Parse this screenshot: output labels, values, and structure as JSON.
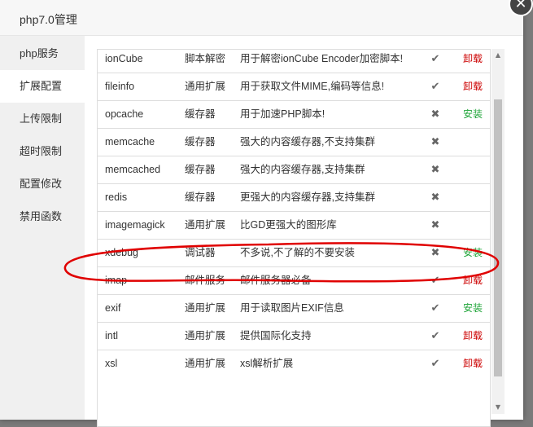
{
  "dialog": {
    "title": "php7.0管理",
    "close_glyph": "✕"
  },
  "sidebar": {
    "items": [
      {
        "label": "php服务",
        "active": false
      },
      {
        "label": "扩展配置",
        "active": true
      },
      {
        "label": "上传限制",
        "active": false
      },
      {
        "label": "超时限制",
        "active": false
      },
      {
        "label": "配置修改",
        "active": false
      },
      {
        "label": "禁用函数",
        "active": false
      }
    ]
  },
  "extensions": {
    "rows": [
      {
        "name": "ionCube",
        "type": "脚本解密",
        "desc": "用于解密ionCube Encoder加密脚本!",
        "installed": true,
        "action": "卸载"
      },
      {
        "name": "fileinfo",
        "type": "通用扩展",
        "desc": "用于获取文件MIME,编码等信息!",
        "installed": true,
        "action": "卸载"
      },
      {
        "name": "opcache",
        "type": "缓存器",
        "desc": "用于加速PHP脚本!",
        "installed": false,
        "action": "安装"
      },
      {
        "name": "memcache",
        "type": "缓存器",
        "desc": "强大的内容缓存器,不支持集群",
        "installed": false,
        "action": ""
      },
      {
        "name": "memcached",
        "type": "缓存器",
        "desc": "强大的内容缓存器,支持集群",
        "installed": false,
        "action": ""
      },
      {
        "name": "redis",
        "type": "缓存器",
        "desc": "更强大的内容缓存器,支持集群",
        "installed": false,
        "action": ""
      },
      {
        "name": "imagemagick",
        "type": "通用扩展",
        "desc": "比GD更强大的图形库",
        "installed": false,
        "action": ""
      },
      {
        "name": "xdebug",
        "type": "调试器",
        "desc": "不多说,不了解的不要安装",
        "installed": false,
        "action": "安装"
      },
      {
        "name": "imap",
        "type": "邮件服务",
        "desc": "邮件服务器必备",
        "installed": true,
        "action": "卸载"
      },
      {
        "name": "exif",
        "type": "通用扩展",
        "desc": "用于读取图片EXIF信息",
        "installed": true,
        "action": "安装"
      },
      {
        "name": "intl",
        "type": "通用扩展",
        "desc": "提供国际化支持",
        "installed": true,
        "action": "卸载"
      },
      {
        "name": "xsl",
        "type": "通用扩展",
        "desc": "xsl解析扩展",
        "installed": true,
        "action": "卸载"
      }
    ]
  },
  "glyphs": {
    "installed": "✔",
    "not_installed": "✖",
    "scroll_up": "▲",
    "scroll_down": "▼"
  },
  "colors": {
    "uninstall": "#cc0000",
    "install": "#20a53a",
    "annotation": "#e00000"
  }
}
